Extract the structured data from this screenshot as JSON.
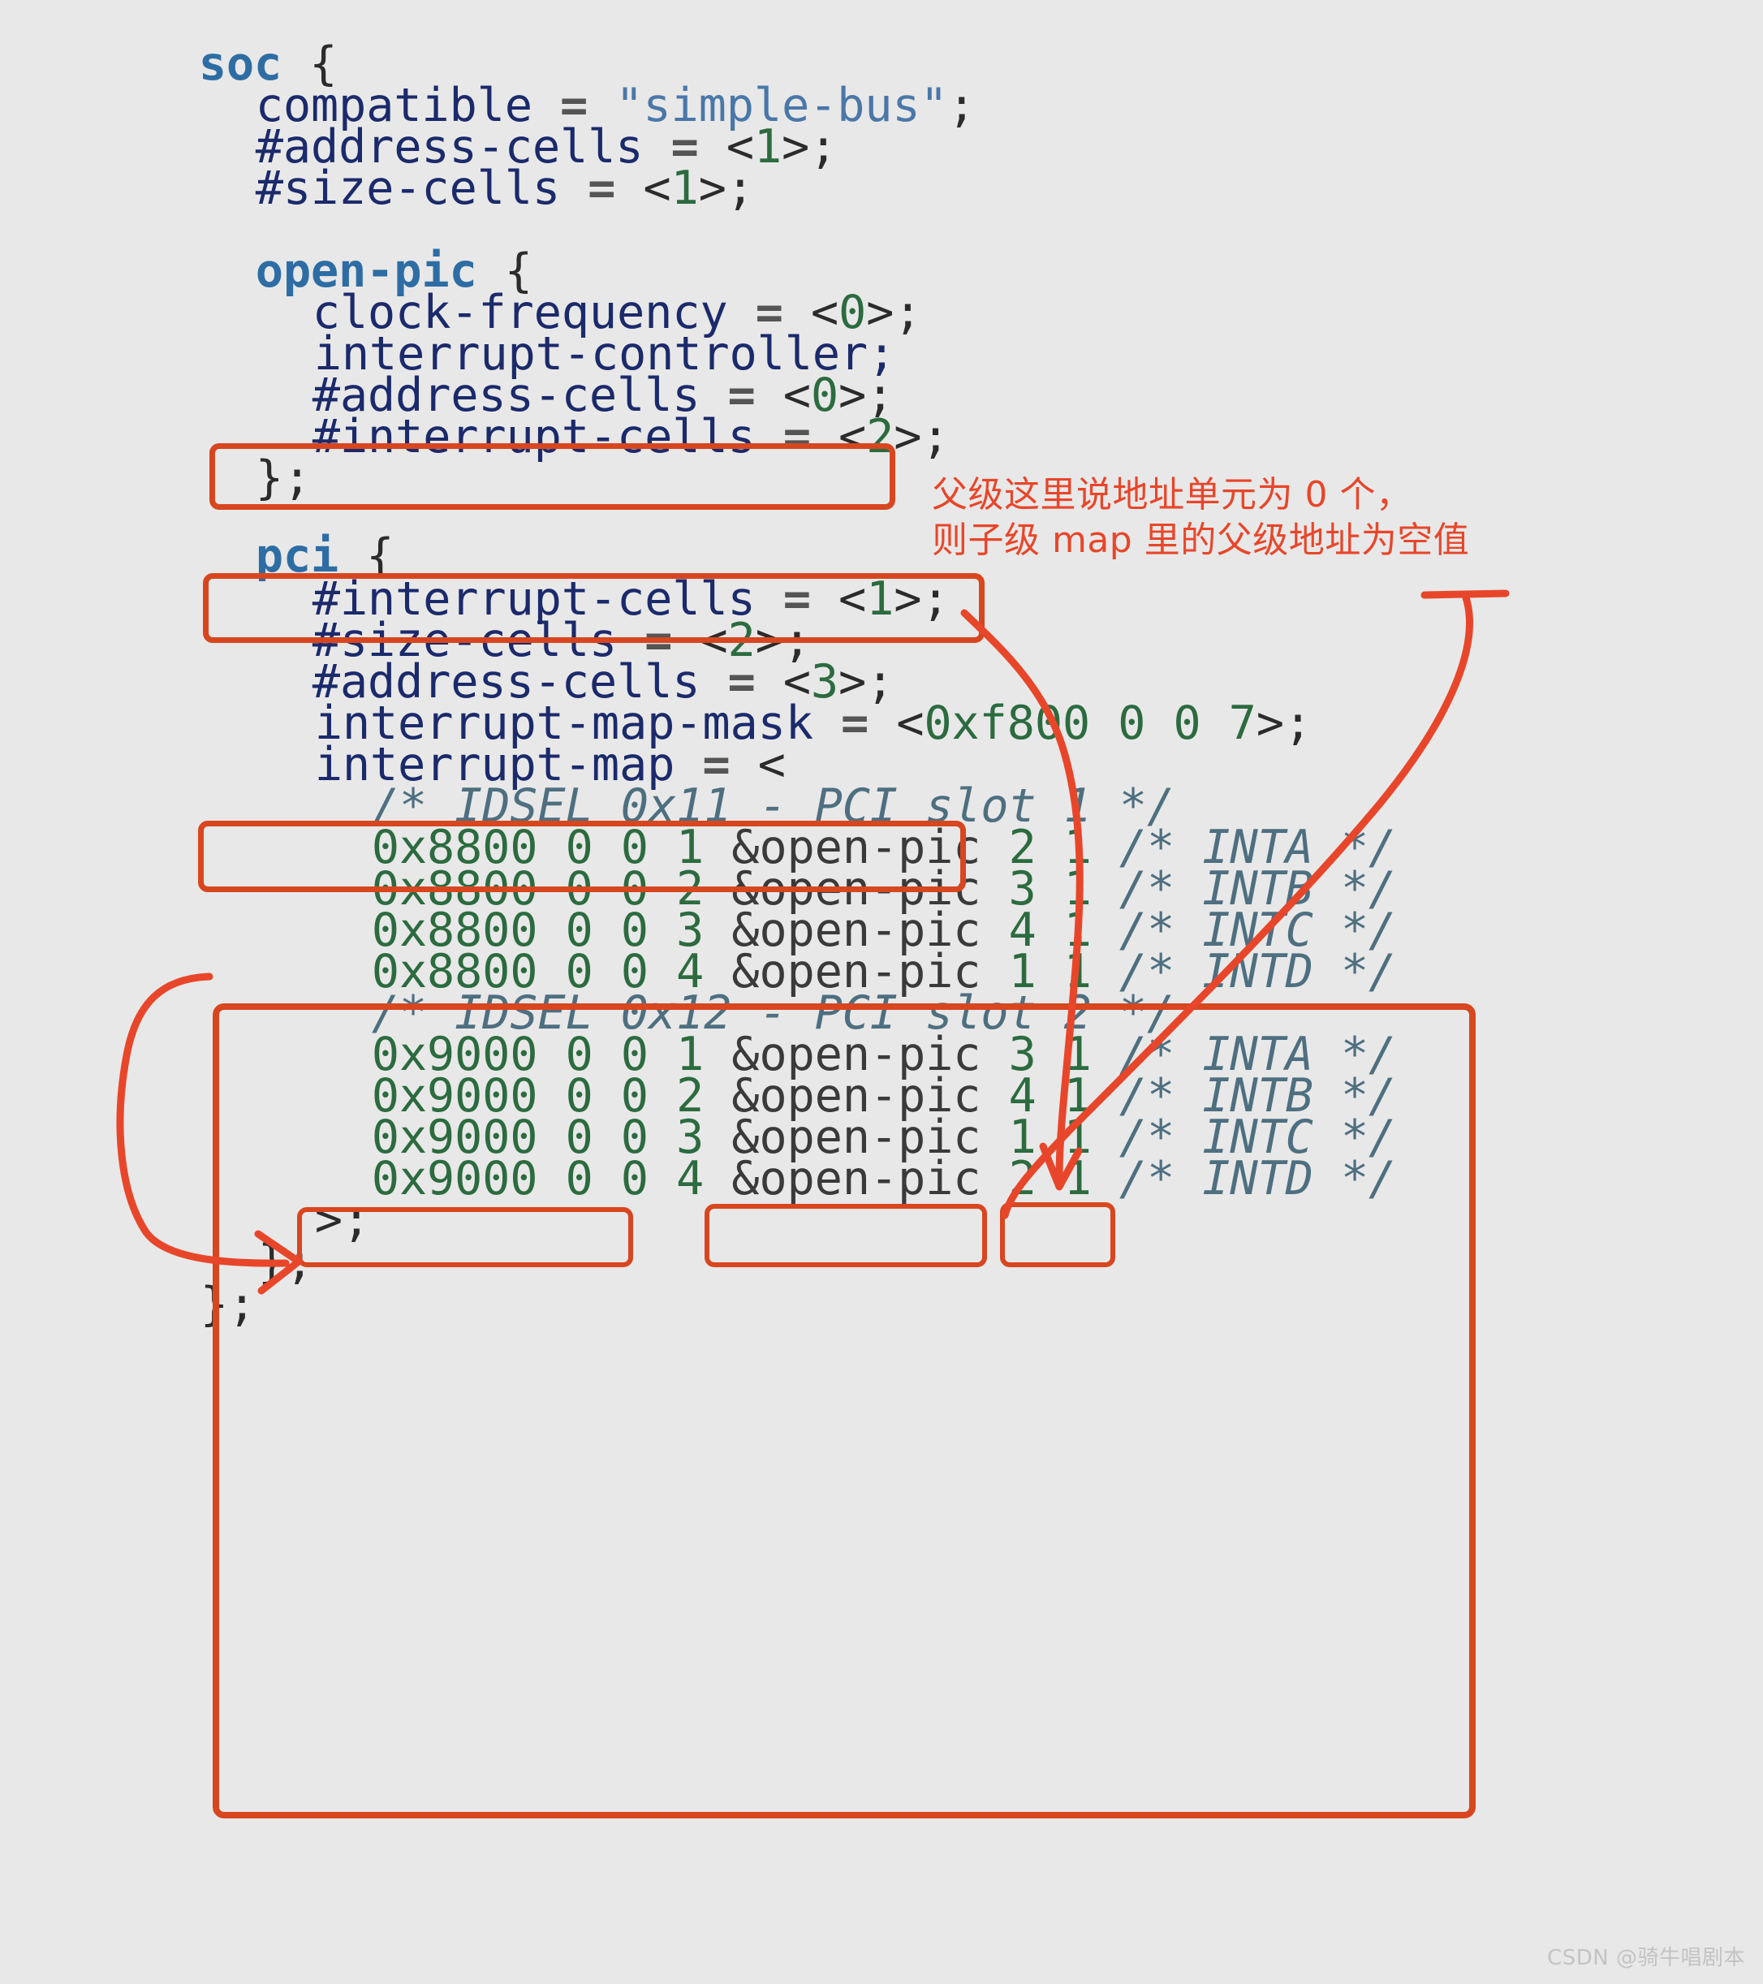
{
  "colors": {
    "background": "#e8e8e8",
    "annotation_red": "#D8461F",
    "node_blue": "#2E6DA4",
    "property_navy": "#1B2A6B",
    "number_green": "#2C6B3F",
    "string_blue": "#4A77A8",
    "comment_slate": "#4E6F80"
  },
  "code": {
    "language": "device-tree-source",
    "lines": [
      {
        "id": "l1",
        "text": "soc {"
      },
      {
        "id": "l2",
        "text": "    compatible = \"simple-bus\";"
      },
      {
        "id": "l3",
        "text": "    #address-cells = <1>;"
      },
      {
        "id": "l4",
        "text": "    #size-cells = <1>;"
      },
      {
        "id": "l5",
        "text": ""
      },
      {
        "id": "l6",
        "text": "    open-pic {"
      },
      {
        "id": "l7",
        "text": "        clock-frequency = <0>;"
      },
      {
        "id": "l8",
        "text": "        interrupt-controller;"
      },
      {
        "id": "l9",
        "text": "        #address-cells = <0>;"
      },
      {
        "id": "l10",
        "text": "        #interrupt-cells = <2>;"
      },
      {
        "id": "l11",
        "text": "    };"
      },
      {
        "id": "l12",
        "text": ""
      },
      {
        "id": "l13",
        "text": "    pci {"
      },
      {
        "id": "l14",
        "text": "        #interrupt-cells = <1>;"
      },
      {
        "id": "l15",
        "text": "        #size-cells = <2>;"
      },
      {
        "id": "l16",
        "text": "        #address-cells = <3>;"
      },
      {
        "id": "l17",
        "text": "        interrupt-map-mask = <0xf800 0 0 7>;"
      },
      {
        "id": "l18",
        "text": "        interrupt-map = <"
      },
      {
        "id": "l19",
        "text": "            /* IDSEL 0x11 - PCI slot 1 */"
      },
      {
        "id": "l20",
        "text": "            0x8800 0 0 1 &open-pic 2 1 /* INTA */"
      },
      {
        "id": "l21",
        "text": "            0x8800 0 0 2 &open-pic 3 1 /* INTB */"
      },
      {
        "id": "l22",
        "text": "            0x8800 0 0 3 &open-pic 4 1 /* INTC */"
      },
      {
        "id": "l23",
        "text": "            0x8800 0 0 4 &open-pic 1 1 /* INTD */"
      },
      {
        "id": "l24",
        "text": "            /* IDSEL 0x12 - PCI slot 2 */"
      },
      {
        "id": "l25",
        "text": "            0x9000 0 0 1 &open-pic 3 1 /* INTA */"
      },
      {
        "id": "l26",
        "text": "            0x9000 0 0 2 &open-pic 4 1 /* INTB */"
      },
      {
        "id": "l27",
        "text": "            0x9000 0 0 3 &open-pic 1 1 /* INTC */"
      },
      {
        "id": "l28",
        "text": "            0x9000 0 0 4 &open-pic 2 1 /* INTD */"
      },
      {
        "id": "l29",
        "text": "        >;"
      },
      {
        "id": "l30",
        "text": "    };"
      },
      {
        "id": "l31",
        "text": "};"
      }
    ],
    "tokens": {
      "soc": "soc",
      "open_pic_node": "open-pic",
      "pci_node": "pci",
      "open_brace": "{",
      "close_brace_semi": "};",
      "compatible_key": "compatible",
      "compatible_value": "\"simple-bus\"",
      "address_cells": "#address-cells",
      "size_cells": "#size-cells",
      "interrupt_cells": "#interrupt-cells",
      "clock_frequency": "clock-frequency",
      "interrupt_controller": "interrupt-controller;",
      "interrupt_map_mask": "interrupt-map-mask",
      "interrupt_map": "interrupt-map",
      "open_pic_ref": "&open-pic",
      "list_close": ">;",
      "equals": "=",
      "angle_open": "<",
      "angle_close": ">",
      "semicolon": ";"
    },
    "values": {
      "soc_address_cells": "1",
      "soc_size_cells": "1",
      "openpic_clock_frequency": "0",
      "openpic_address_cells": "0",
      "openpic_interrupt_cells": "2",
      "pci_interrupt_cells": "1",
      "pci_size_cells": "2",
      "pci_address_cells": "3",
      "interrupt_map_mask_value": "0xf800 0 0 7"
    },
    "comments": {
      "idsel_slot1": "/* IDSEL 0x11 - PCI slot 1 */",
      "idsel_slot2": "/* IDSEL 0x12 - PCI slot 2 */",
      "inta": "/* INTA */",
      "intb": "/* INTB */",
      "intc": "/* INTC */",
      "intd": "/* INTD */"
    }
  },
  "interrupt_map_rows": [
    {
      "child_addr": "0x8800 0 0",
      "child_irq": "1",
      "parent": "&open-pic",
      "parent_irq": "2 1",
      "comment": "/* INTA */"
    },
    {
      "child_addr": "0x8800 0 0",
      "child_irq": "2",
      "parent": "&open-pic",
      "parent_irq": "3 1",
      "comment": "/* INTB */"
    },
    {
      "child_addr": "0x8800 0 0",
      "child_irq": "3",
      "parent": "&open-pic",
      "parent_irq": "4 1",
      "comment": "/* INTC */"
    },
    {
      "child_addr": "0x8800 0 0",
      "child_irq": "4",
      "parent": "&open-pic",
      "parent_irq": "1 1",
      "comment": "/* INTD */"
    },
    {
      "child_addr": "0x9000 0 0",
      "child_irq": "1",
      "parent": "&open-pic",
      "parent_irq": "3 1",
      "comment": "/* INTA */"
    },
    {
      "child_addr": "0x9000 0 0",
      "child_irq": "2",
      "parent": "&open-pic",
      "parent_irq": "4 1",
      "comment": "/* INTB */"
    },
    {
      "child_addr": "0x9000 0 0",
      "child_irq": "3",
      "parent": "&open-pic",
      "parent_irq": "1 1",
      "comment": "/* INTC */"
    },
    {
      "child_addr": "0x9000 0 0",
      "child_irq": "4",
      "parent": "&open-pic",
      "parent_irq": "2 1",
      "comment": "/* INTD */"
    }
  ],
  "annotation": {
    "note_line1": "父级这里说地址单元为 0 个，",
    "note_line2": "则子级 map 里的父级地址为空值",
    "note_full": "父级这里说地址单元为 0 个，\n则子级 map 里的父级地址为空值"
  },
  "watermark": {
    "text": "CSDN @骑牛唱剧本"
  }
}
